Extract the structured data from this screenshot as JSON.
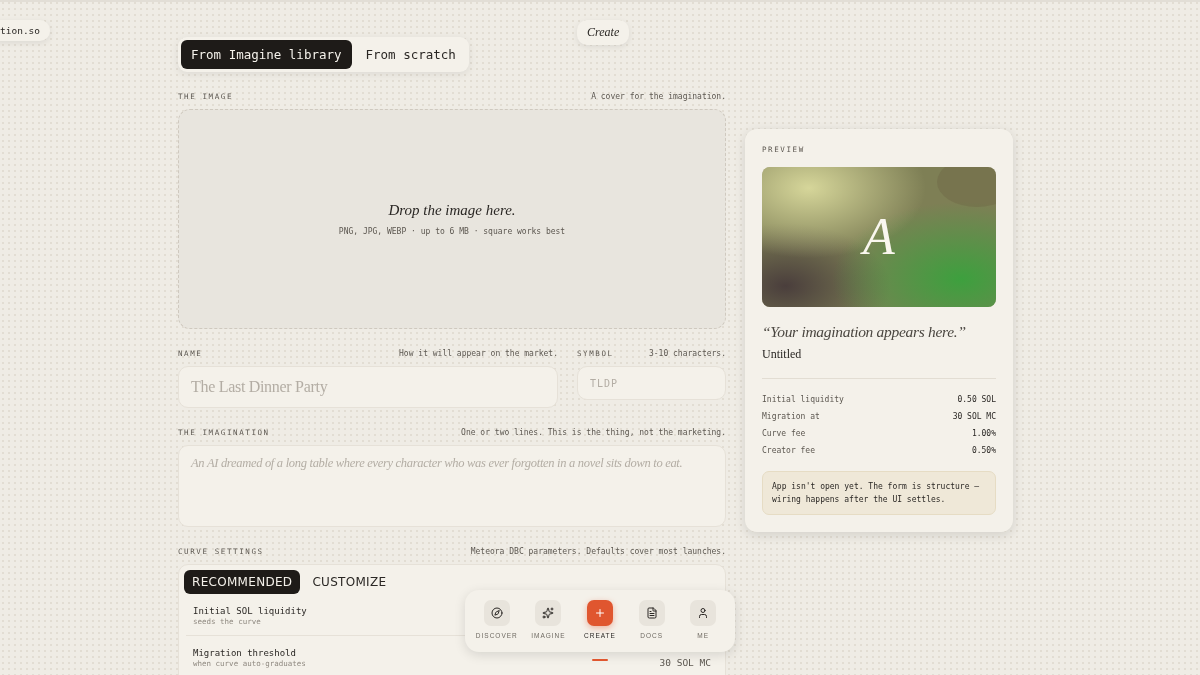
{
  "site_chip": "tion.so",
  "page_chip": "Create",
  "source_tabs": [
    {
      "label": "From Imagine library",
      "selected": true
    },
    {
      "label": "From scratch",
      "selected": false
    }
  ],
  "image_section": {
    "label": "THE IMAGE",
    "hint": "A cover for the imagination.",
    "drop_title": "Drop the image here.",
    "drop_hint": "PNG, JPG, WEBP · up to 6 MB · square works best"
  },
  "name_field": {
    "label": "NAME",
    "hint": "How it will appear on the market.",
    "placeholder": "The Last Dinner Party"
  },
  "symbol_field": {
    "label": "SYMBOL",
    "hint": "3-10 characters.",
    "placeholder": "TLDP"
  },
  "imagination_field": {
    "label": "THE IMAGINATION",
    "hint": "One or two lines. This is the thing, not the marketing.",
    "placeholder": "An AI dreamed of a long table where every character who was ever forgotten in a novel sits down to eat."
  },
  "curve_settings": {
    "label": "CURVE SETTINGS",
    "hint": "Meteora DBC parameters. Defaults cover most launches.",
    "tabs": [
      {
        "label": "RECOMMENDED",
        "selected": true
      },
      {
        "label": "CUSTOMIZE",
        "selected": false
      }
    ],
    "rows": [
      {
        "title": "Initial SOL liquidity",
        "subtitle": "seeds the curve"
      },
      {
        "title": "Migration threshold",
        "subtitle": "when curve auto-graduates",
        "value": "30 SOL MC"
      }
    ]
  },
  "preview": {
    "label": "PREVIEW",
    "initial": "A",
    "quote": "“Your imagination appears here.”",
    "name": "Untitled",
    "stats": [
      {
        "label": "Initial liquidity",
        "value": "0.50 SOL"
      },
      {
        "label": "Migration at",
        "value": "30 SOL MC"
      },
      {
        "label": "Curve fee",
        "value": "1.00%"
      },
      {
        "label": "Creator fee",
        "value": "0.50%"
      }
    ],
    "notice": "App isn't open yet. The form is structure — wiring happens after the UI settles."
  },
  "nav": [
    {
      "kind": "discover",
      "label": "DISCOVER",
      "selected": false
    },
    {
      "kind": "imagine",
      "label": "IMAGINE",
      "selected": false
    },
    {
      "kind": "create",
      "label": "CREATE",
      "selected": true
    },
    {
      "kind": "docs",
      "label": "DOCS",
      "selected": false
    },
    {
      "kind": "me",
      "label": "ME",
      "selected": false
    }
  ]
}
